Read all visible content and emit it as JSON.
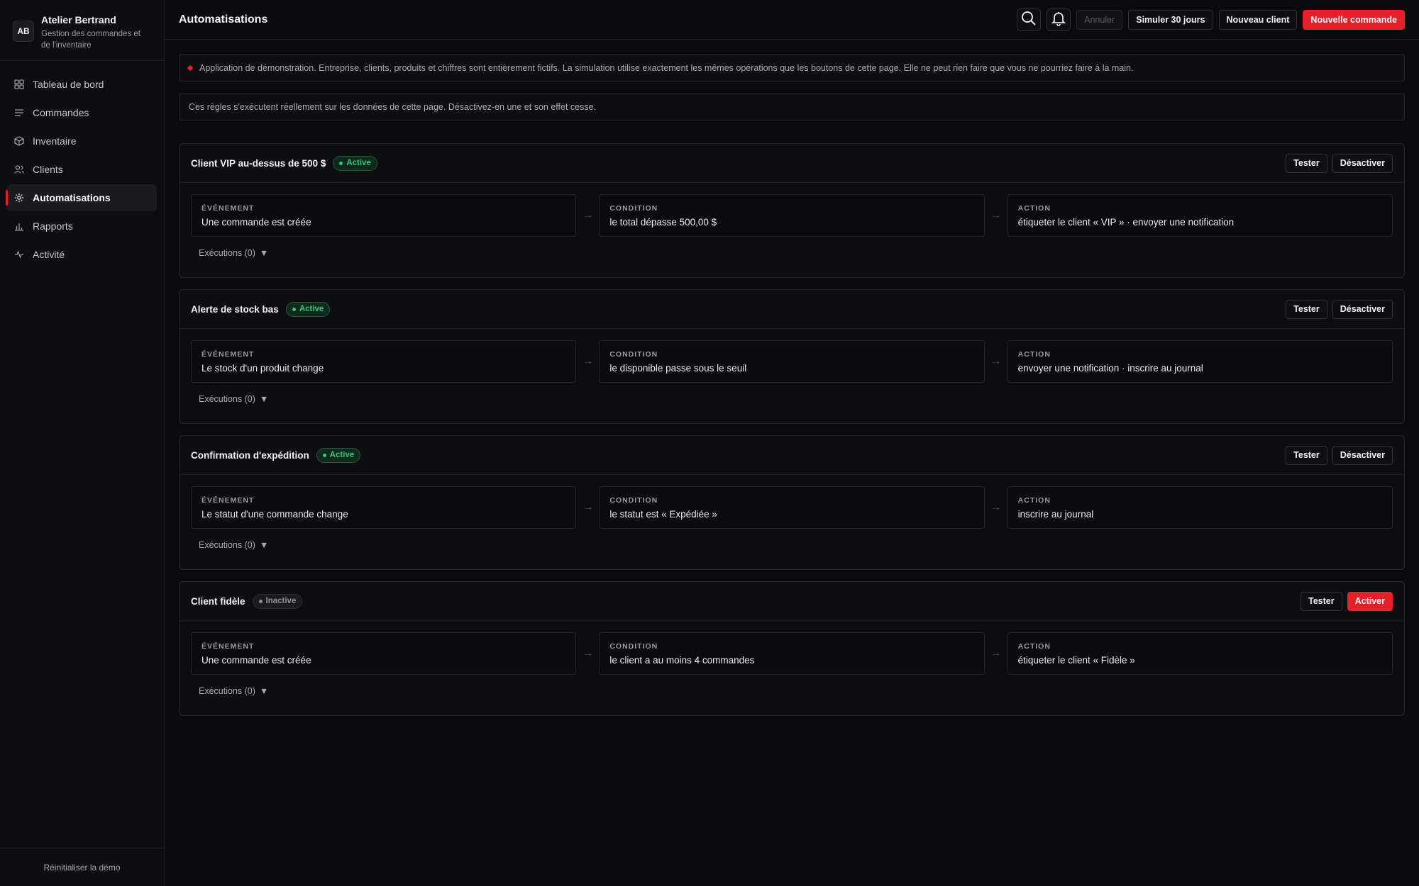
{
  "brand": {
    "initials": "AB",
    "name": "Atelier Bertrand",
    "subtitle_line1": "Gestion des commandes et",
    "subtitle_line2": "de l'inventaire"
  },
  "nav": [
    {
      "label": "Tableau de bord",
      "icon": "dashboard-icon",
      "active": false
    },
    {
      "label": "Commandes",
      "icon": "list-icon",
      "active": false
    },
    {
      "label": "Inventaire",
      "icon": "box-icon",
      "active": false
    },
    {
      "label": "Clients",
      "icon": "users-icon",
      "active": false
    },
    {
      "label": "Automatisations",
      "icon": "gear-icon",
      "active": true
    },
    {
      "label": "Rapports",
      "icon": "bar-chart-icon",
      "active": false
    },
    {
      "label": "Activité",
      "icon": "activity-icon",
      "active": false
    }
  ],
  "sidebar_footer": "Réinitialiser la démo",
  "header": {
    "title": "Automatisations",
    "undo_label": "Annuler",
    "simulate_label": "Simuler 30 jours",
    "new_client_label": "Nouveau client",
    "new_order_label": "Nouvelle commande"
  },
  "banner": "Application de démonstration. Entreprise, clients, produits et chiffres sont entièrement fictifs. La simulation utilise exactement les mêmes opérations que les boutons de cette page. Elle ne peut rien faire que vous ne pourriez faire à la main.",
  "info": "Ces règles s'exécutent réellement sur les données de cette page. Désactivez-en une et son effet cesse.",
  "labels": {
    "event": "ÉVÉNEMENT",
    "condition": "CONDITION",
    "action": "ACTION",
    "test": "Tester"
  },
  "rules": [
    {
      "title": "Client VIP au-dessus de 500 $",
      "status": "Active",
      "active": true,
      "toggle_label": "Désactiver",
      "event": "Une commande est créée",
      "condition": "le total dépasse 500,00 $",
      "action": "étiqueter le client « VIP » · envoyer une notification",
      "runs": "Exécutions (0)"
    },
    {
      "title": "Alerte de stock bas",
      "status": "Active",
      "active": true,
      "toggle_label": "Désactiver",
      "event": "Le stock d'un produit change",
      "condition": "le disponible passe sous le seuil",
      "action": "envoyer une notification · inscrire au journal",
      "runs": "Exécutions (0)"
    },
    {
      "title": "Confirmation d'expédition",
      "status": "Active",
      "active": true,
      "toggle_label": "Désactiver",
      "event": "Le statut d'une commande change",
      "condition": "le statut est « Expédiée »",
      "action": "inscrire au journal",
      "runs": "Exécutions (0)"
    },
    {
      "title": "Client fidèle",
      "status": "Inactive",
      "active": false,
      "toggle_label": "Activer",
      "event": "Une commande est créée",
      "condition": "le client a au moins 4 commandes",
      "action": "étiqueter le client « Fidèle »",
      "runs": "Exécutions (0)"
    }
  ],
  "colors": {
    "accent": "#e5202a",
    "active_green": "#34c27a",
    "background": "#0b0b0d"
  }
}
